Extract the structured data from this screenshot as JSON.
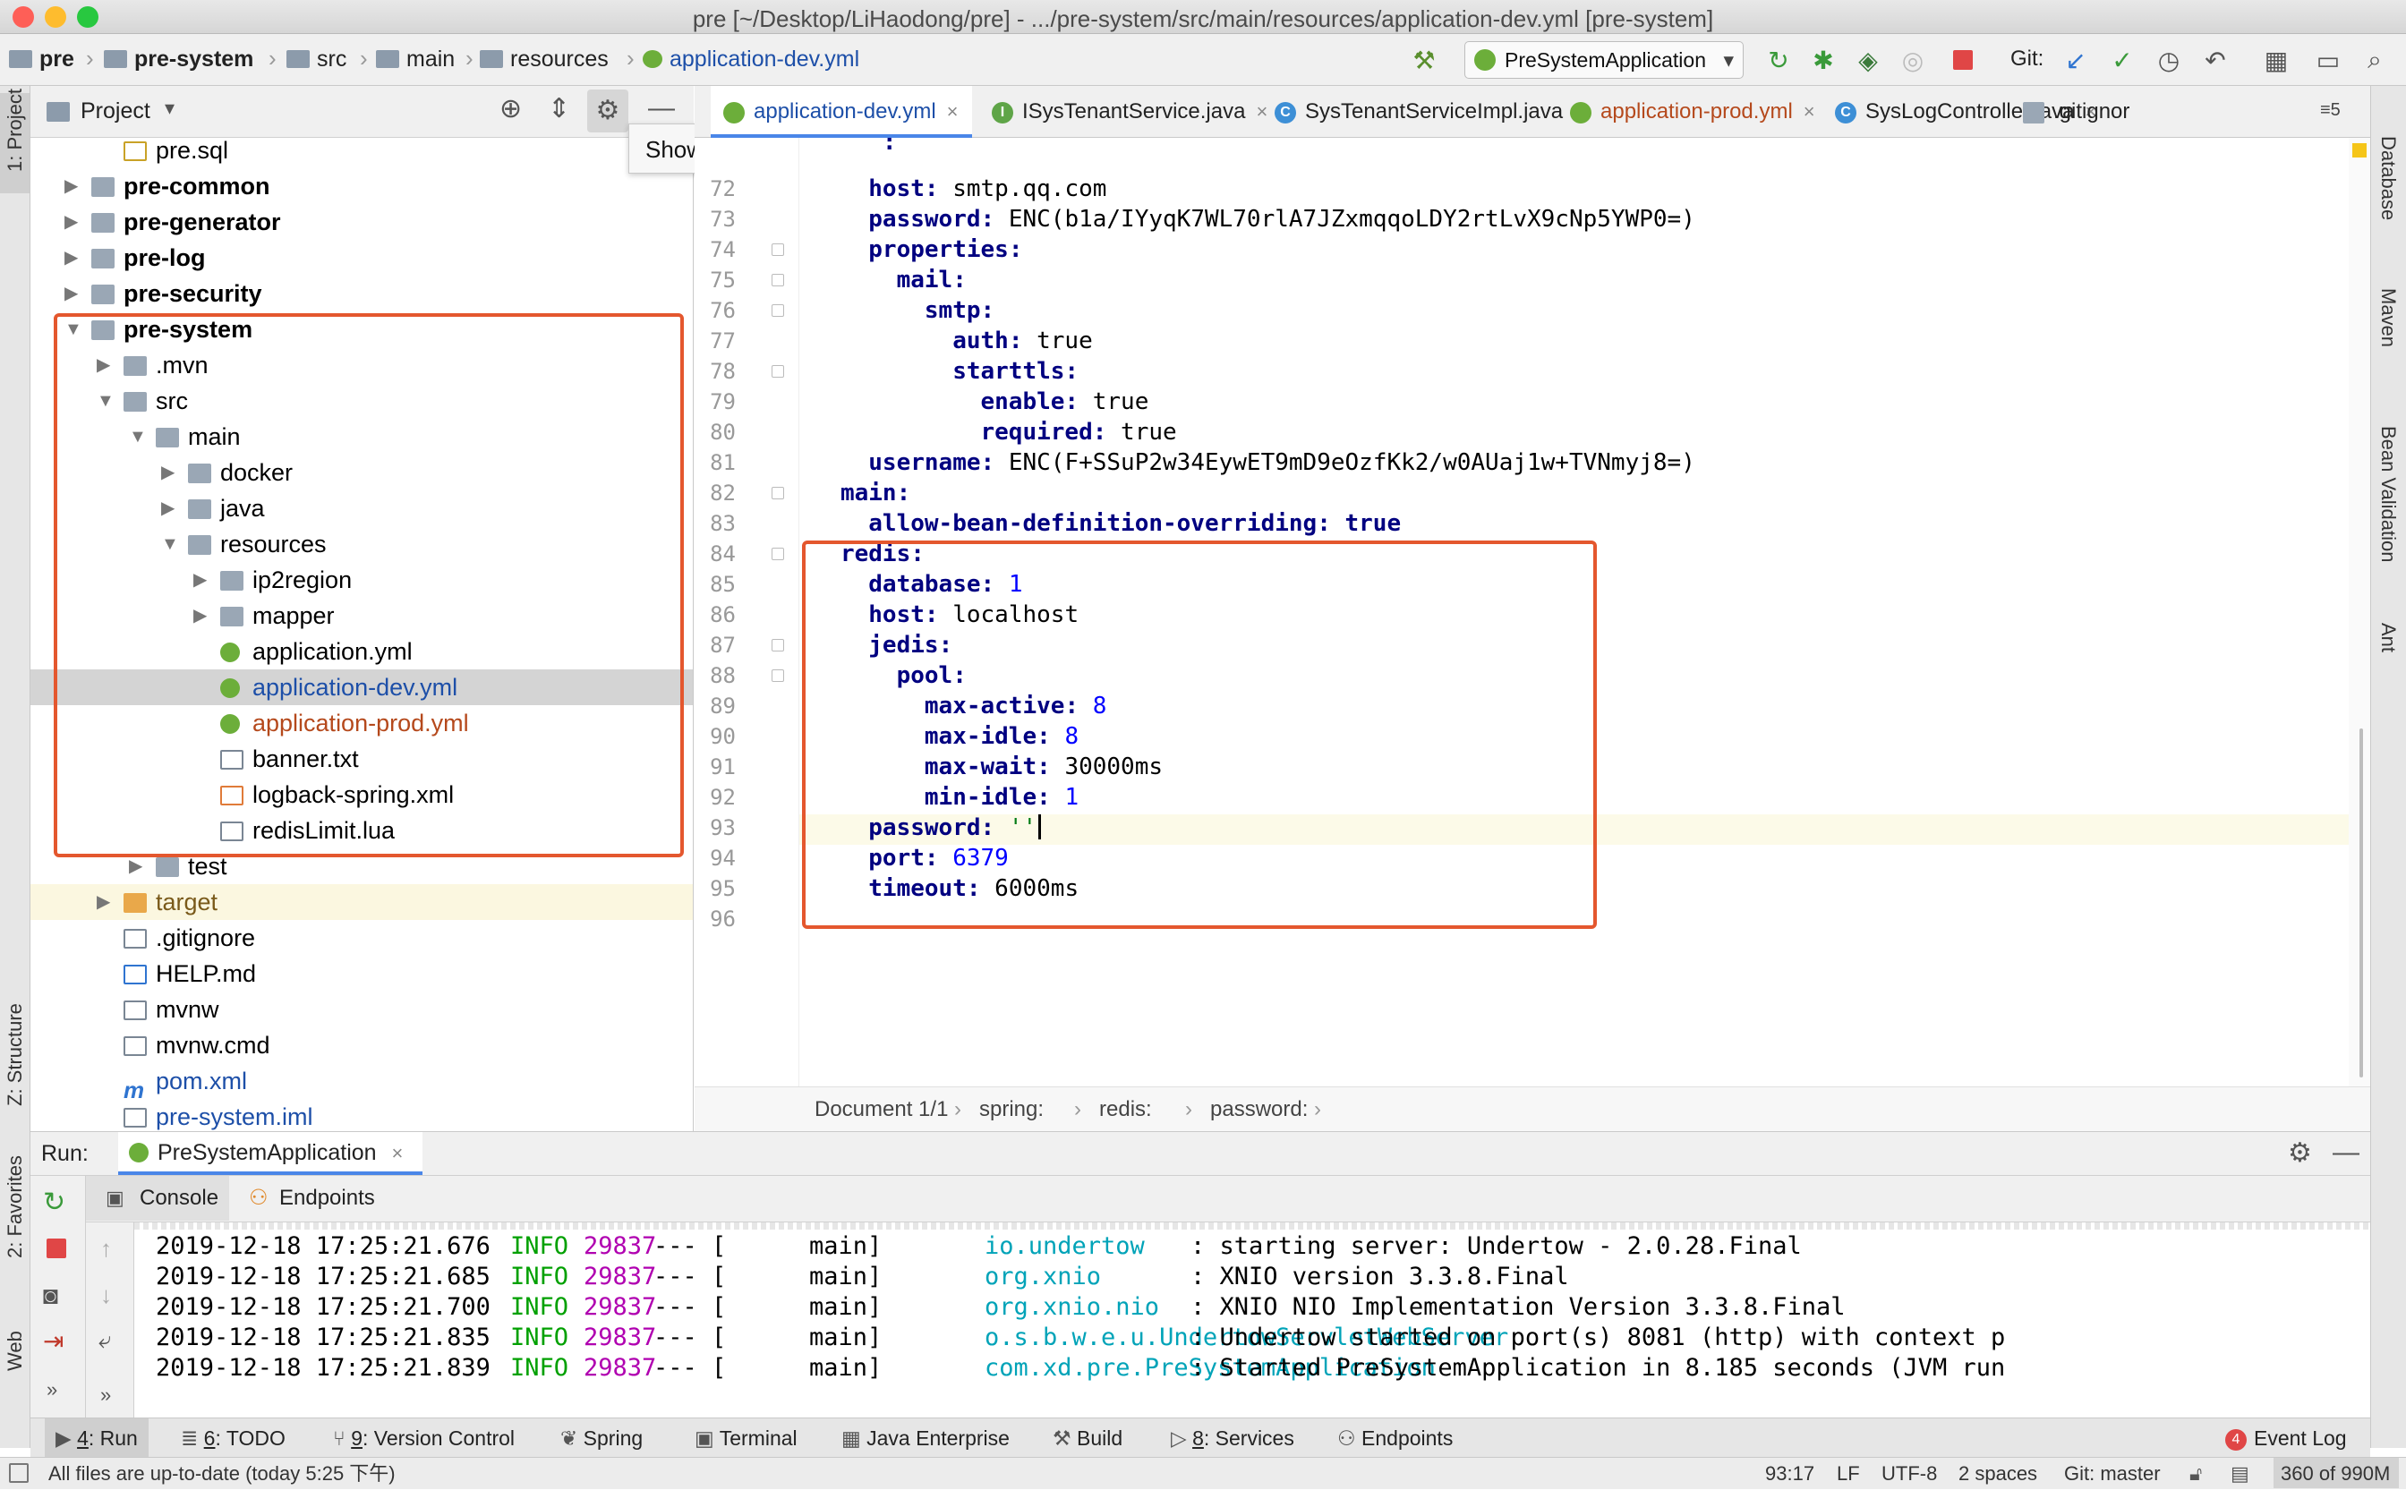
{
  "window": {
    "title": "pre [~/Desktop/LiHaodong/pre] - .../pre-system/src/main/resources/application-dev.yml [pre-system]"
  },
  "breadcrumbs": [
    "pre",
    "pre-system",
    "src",
    "main",
    "resources",
    "application-dev.yml"
  ],
  "run_config": "PreSystemApplication",
  "git_label": "Git:",
  "project_panel": {
    "title": "Project",
    "tooltip": "Show Options Menu",
    "tree": [
      {
        "label": "pre.sql",
        "depth": 2,
        "kind": "sql"
      },
      {
        "label": "pre-common",
        "depth": 1,
        "kind": "module",
        "bold": true
      },
      {
        "label": "pre-generator",
        "depth": 1,
        "kind": "module",
        "bold": true
      },
      {
        "label": "pre-log",
        "depth": 1,
        "kind": "module",
        "bold": true
      },
      {
        "label": "pre-security",
        "depth": 1,
        "kind": "module",
        "bold": true
      },
      {
        "label": "pre-system",
        "depth": 1,
        "kind": "module",
        "bold": true,
        "expanded": true
      },
      {
        "label": ".mvn",
        "depth": 2,
        "kind": "folder"
      },
      {
        "label": "src",
        "depth": 2,
        "kind": "folder",
        "expanded": true
      },
      {
        "label": "main",
        "depth": 3,
        "kind": "folder",
        "expanded": true
      },
      {
        "label": "docker",
        "depth": 4,
        "kind": "folder"
      },
      {
        "label": "java",
        "depth": 4,
        "kind": "folder"
      },
      {
        "label": "resources",
        "depth": 4,
        "kind": "folder",
        "expanded": true
      },
      {
        "label": "ip2region",
        "depth": 5,
        "kind": "folder"
      },
      {
        "label": "mapper",
        "depth": 5,
        "kind": "folder"
      },
      {
        "label": "application.yml",
        "depth": 5,
        "kind": "yml"
      },
      {
        "label": "application-dev.yml",
        "depth": 5,
        "kind": "yml",
        "selected": true
      },
      {
        "label": "application-prod.yml",
        "depth": 5,
        "kind": "yml",
        "modified": true
      },
      {
        "label": "banner.txt",
        "depth": 5,
        "kind": "file"
      },
      {
        "label": "logback-spring.xml",
        "depth": 5,
        "kind": "xml"
      },
      {
        "label": "redisLimit.lua",
        "depth": 5,
        "kind": "file"
      },
      {
        "label": "test",
        "depth": 3,
        "kind": "folder"
      },
      {
        "label": "target",
        "depth": 2,
        "kind": "folder-orange",
        "highlight": true
      },
      {
        "label": ".gitignore",
        "depth": 2,
        "kind": "file"
      },
      {
        "label": "HELP.md",
        "depth": 2,
        "kind": "md"
      },
      {
        "label": "mvnw",
        "depth": 2,
        "kind": "file"
      },
      {
        "label": "mvnw.cmd",
        "depth": 2,
        "kind": "file"
      },
      {
        "label": "pom.xml",
        "depth": 2,
        "kind": "maven",
        "blue": true
      },
      {
        "label": "pre-system.iml",
        "depth": 2,
        "kind": "file",
        "blue": true
      }
    ]
  },
  "editor_tabs": [
    {
      "label": "application-dev.yml",
      "icon": "yml",
      "active": true
    },
    {
      "label": "ISysTenantService.java",
      "icon": "interface"
    },
    {
      "label": "SysTenantServiceImpl.java",
      "icon": "class"
    },
    {
      "label": "application-prod.yml",
      "icon": "yml",
      "modified": true
    },
    {
      "label": "SysLogController.java",
      "icon": "class"
    },
    {
      "label": ".gitignor",
      "icon": "file"
    }
  ],
  "editor_tabs_overflow": "5",
  "code_lines": [
    {
      "n": "72",
      "indent": 2,
      "key": "host",
      "val": "smtp.qq.com",
      "vtype": "plain"
    },
    {
      "n": "73",
      "indent": 2,
      "key": "password",
      "val": "ENC(b1a/IYyqK7WL70rlA7JZxmqqoLDY2rtLvX9cNp5YWP0=)",
      "vtype": "plain"
    },
    {
      "n": "74",
      "indent": 2,
      "key": "properties",
      "val": "",
      "vtype": "plain"
    },
    {
      "n": "75",
      "indent": 3,
      "key": "mail",
      "val": "",
      "vtype": "plain"
    },
    {
      "n": "76",
      "indent": 4,
      "key": "smtp",
      "val": "",
      "vtype": "plain"
    },
    {
      "n": "77",
      "indent": 5,
      "key": "auth",
      "val": "true",
      "vtype": "plain"
    },
    {
      "n": "78",
      "indent": 5,
      "key": "starttls",
      "val": "",
      "vtype": "plain"
    },
    {
      "n": "79",
      "indent": 6,
      "key": "enable",
      "val": "true",
      "vtype": "plain"
    },
    {
      "n": "80",
      "indent": 6,
      "key": "required",
      "val": "true",
      "vtype": "plain"
    },
    {
      "n": "81",
      "indent": 2,
      "key": "username",
      "val": "ENC(F+SSuP2w34EywET9mD9eOzfKk2/w0AUaj1w+TVNmyj8=)",
      "vtype": "plain"
    },
    {
      "n": "82",
      "indent": 1,
      "key": "main",
      "val": "",
      "vtype": "plain"
    },
    {
      "n": "83",
      "indent": 2,
      "key": "allow-bean-definition-overriding",
      "val": "true",
      "vtype": "bold"
    },
    {
      "n": "84",
      "indent": 1,
      "key": "redis",
      "val": "",
      "vtype": "plain"
    },
    {
      "n": "85",
      "indent": 2,
      "key": "database",
      "val": "1",
      "vtype": "num"
    },
    {
      "n": "86",
      "indent": 2,
      "key": "host",
      "val": "localhost",
      "vtype": "plain"
    },
    {
      "n": "87",
      "indent": 2,
      "key": "jedis",
      "val": "",
      "vtype": "plain"
    },
    {
      "n": "88",
      "indent": 3,
      "key": "pool",
      "val": "",
      "vtype": "plain"
    },
    {
      "n": "89",
      "indent": 4,
      "key": "max-active",
      "val": "8",
      "vtype": "num"
    },
    {
      "n": "90",
      "indent": 4,
      "key": "max-idle",
      "val": "8",
      "vtype": "num"
    },
    {
      "n": "91",
      "indent": 4,
      "key": "max-wait",
      "val": "30000ms",
      "vtype": "plain"
    },
    {
      "n": "92",
      "indent": 4,
      "key": "min-idle",
      "val": "1",
      "vtype": "num"
    },
    {
      "n": "93",
      "indent": 2,
      "key": "password",
      "val": "''",
      "vtype": "str",
      "current": true
    },
    {
      "n": "94",
      "indent": 2,
      "key": "port",
      "val": "6379",
      "vtype": "num"
    },
    {
      "n": "95",
      "indent": 2,
      "key": "timeout",
      "val": "6000ms",
      "vtype": "plain"
    },
    {
      "n": "96",
      "indent": 0,
      "key": "",
      "val": "",
      "vtype": "plain"
    }
  ],
  "editor_breadcrumb": [
    "Document 1/1",
    "spring:",
    "redis:",
    "password:"
  ],
  "run_panel": {
    "label": "Run:",
    "config": "PreSystemApplication",
    "tabs": [
      "Console",
      "Endpoints"
    ],
    "log": [
      {
        "ts": "2019-12-18 17:25:21.676",
        "level": "INFO",
        "pid": "29837",
        "sep": "--- [",
        "thread": "main]",
        "logger": "io.undertow",
        "msg": ": starting server: Undertow - 2.0.28.Final"
      },
      {
        "ts": "2019-12-18 17:25:21.685",
        "level": "INFO",
        "pid": "29837",
        "sep": "--- [",
        "thread": "main]",
        "logger": "org.xnio",
        "msg": ": XNIO version 3.3.8.Final"
      },
      {
        "ts": "2019-12-18 17:25:21.700",
        "level": "INFO",
        "pid": "29837",
        "sep": "--- [",
        "thread": "main]",
        "logger": "org.xnio.nio",
        "msg": ": XNIO NIO Implementation Version 3.3.8.Final"
      },
      {
        "ts": "2019-12-18 17:25:21.835",
        "level": "INFO",
        "pid": "29837",
        "sep": "--- [",
        "thread": "main]",
        "logger": "o.s.b.w.e.u.UndertowServletWebServer",
        "msg": ": Undertow started on port(s) 8081 (http) with context p"
      },
      {
        "ts": "2019-12-18 17:25:21.839",
        "level": "INFO",
        "pid": "29837",
        "sep": "--- [",
        "thread": "main]",
        "logger": "com.xd.pre.PreSystemApplication",
        "msg": ": Started PreSystemApplication in 8.185 seconds (JVM run"
      }
    ]
  },
  "bottom_tools": [
    {
      "num": "4",
      "label": ": Run",
      "active": true
    },
    {
      "num": "6",
      "label": ": TODO"
    },
    {
      "num": "9",
      "label": ": Version Control"
    },
    {
      "num": "",
      "label": "Spring"
    },
    {
      "num": "",
      "label": "Terminal"
    },
    {
      "num": "",
      "label": "Java Enterprise"
    },
    {
      "num": "",
      "label": "Build"
    },
    {
      "num": "8",
      "label": ": Services"
    },
    {
      "num": "",
      "label": "Endpoints"
    }
  ],
  "event_log": {
    "count": "4",
    "label": "Event Log"
  },
  "left_strip": [
    "1: Project",
    "Z: Structure",
    "2: Favorites",
    "Web"
  ],
  "right_strip": [
    "Database",
    "Maven",
    "Bean Validation",
    "Ant"
  ],
  "status": {
    "message": "All files are up-to-date (today 5:25 下午)",
    "position": "93:17",
    "line_sep": "LF",
    "encoding": "UTF-8",
    "indent": "2 spaces",
    "git": "Git: master",
    "memory": "360 of 990M"
  },
  "colors": {
    "accent": "#4a86e8",
    "annotation_box": "#e4572e",
    "selection": "#d4d4d4"
  }
}
